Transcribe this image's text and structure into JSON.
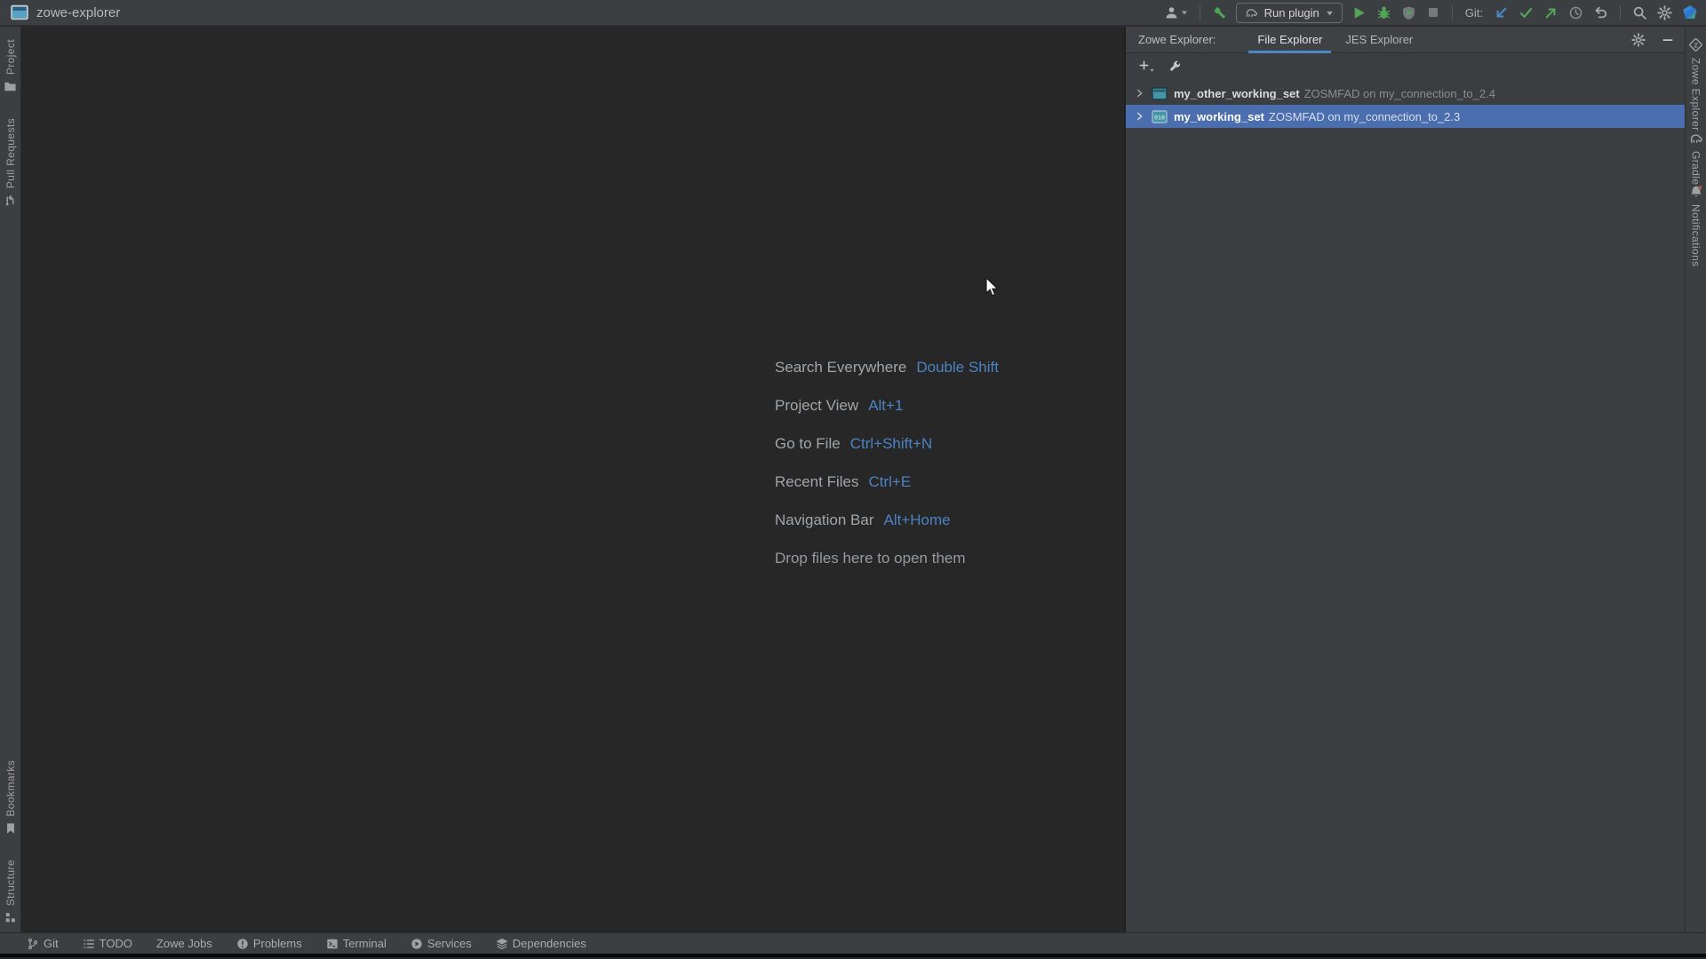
{
  "titlebar": {
    "title": "zowe-explorer"
  },
  "toolbar": {
    "run_config_label": "Run plugin",
    "git_label": "Git:"
  },
  "left_stripe": {
    "top": [
      {
        "label": "Project"
      },
      {
        "label": "Pull Requests"
      }
    ],
    "bottom": [
      {
        "label": "Bookmarks"
      },
      {
        "label": "Structure"
      }
    ]
  },
  "right_stripe": [
    {
      "label": "Zowe Explorer"
    },
    {
      "label": "Gradle"
    },
    {
      "label": "Notifications"
    }
  ],
  "tool_window": {
    "title": "Zowe Explorer:",
    "tabs": [
      {
        "label": "File Explorer"
      },
      {
        "label": "JES Explorer"
      }
    ],
    "tree": [
      {
        "name": "my_other_working_set",
        "detail": "ZOSMFAD on my_connection_to_2.4",
        "selected": false
      },
      {
        "name": "my_working_set",
        "detail": "ZOSMFAD on my_connection_to_2.3",
        "selected": true
      }
    ]
  },
  "shortcuts": {
    "items": [
      {
        "label": "Search Everywhere",
        "keys": "Double Shift"
      },
      {
        "label": "Project View",
        "keys": "Alt+1"
      },
      {
        "label": "Go to File",
        "keys": "Ctrl+Shift+N"
      },
      {
        "label": "Recent Files",
        "keys": "Ctrl+E"
      },
      {
        "label": "Navigation Bar",
        "keys": "Alt+Home"
      }
    ],
    "drop_hint": "Drop files here to open them"
  },
  "status_bar": {
    "items": [
      "Git",
      "TODO",
      "Zowe Jobs",
      "Problems",
      "Terminal",
      "Services",
      "Dependencies"
    ]
  },
  "colors": {
    "selection_blue": "#4b6eaf",
    "tab_underline_blue": "#4a88c7",
    "shortcut_key_blue": "#4c83c3",
    "run_green": "#4fa654",
    "git_update_blue": "#4a88c7",
    "panel_bg": "#3c3f41",
    "editor_bg": "#272727"
  }
}
